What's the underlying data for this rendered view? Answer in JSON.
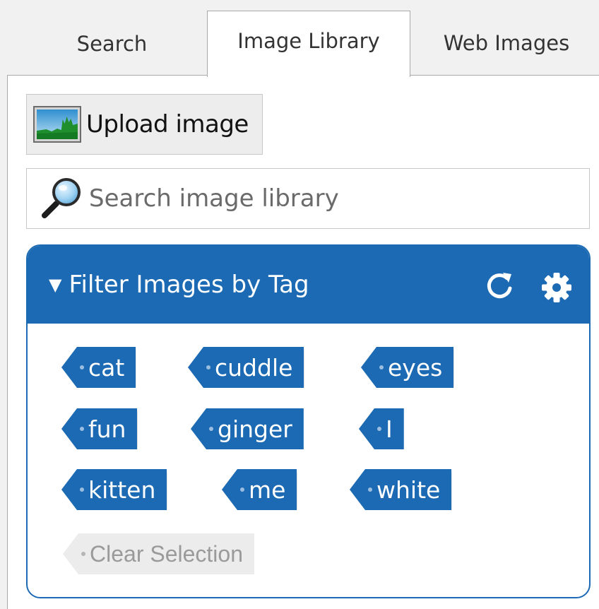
{
  "tabs": [
    {
      "label": "Search"
    },
    {
      "label": "Image Library",
      "active": true
    },
    {
      "label": "Web Images"
    }
  ],
  "upload": {
    "label": "Upload image",
    "icon": "image-icon"
  },
  "search": {
    "placeholder": "Search image library",
    "value": "",
    "icon": "magnifier-icon"
  },
  "filter": {
    "title": "Filter Images by Tag",
    "caret": "▼",
    "icons": {
      "refresh": "refresh-icon",
      "settings": "gear-icon"
    },
    "tags": [
      "cat",
      "cuddle",
      "eyes",
      "fun",
      "ginger",
      "I",
      "kitten",
      "me",
      "white"
    ],
    "clear_label": "Clear Selection"
  },
  "colors": {
    "accent": "#1c6ab3",
    "background": "#f1f1f1",
    "panel": "#ffffff",
    "clear_tag": "#ececec"
  }
}
